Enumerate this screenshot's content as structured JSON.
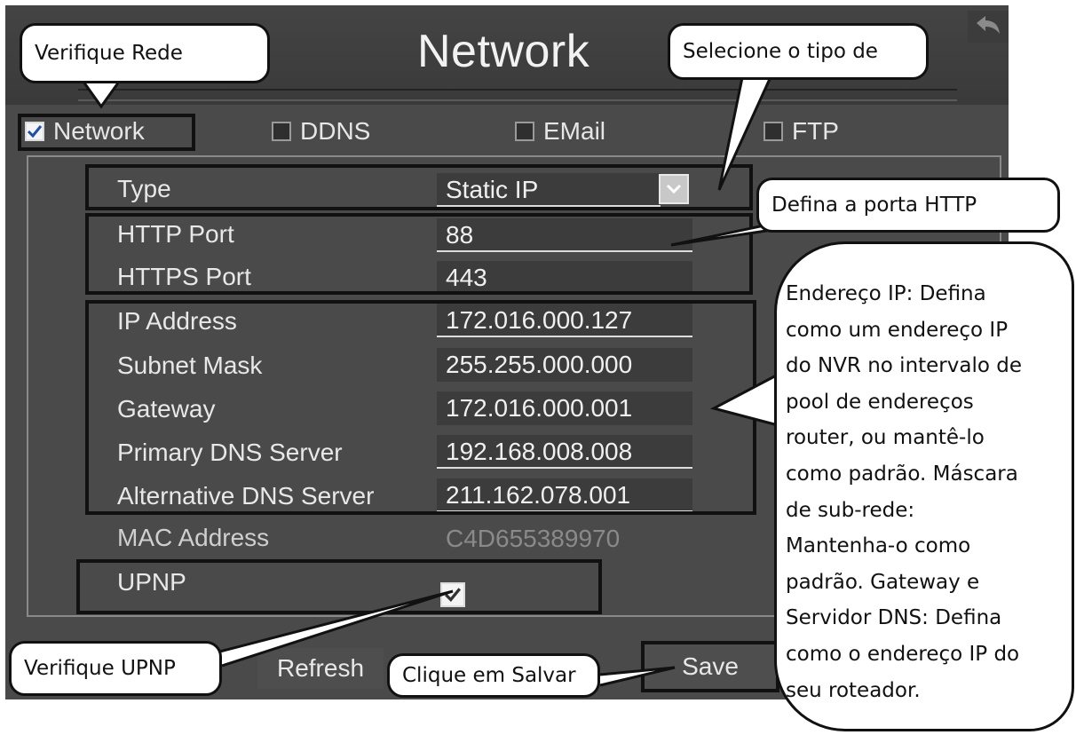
{
  "window": {
    "title": "Network"
  },
  "tabs": [
    {
      "label": "Network",
      "checked": true
    },
    {
      "label": "DDNS",
      "checked": false
    },
    {
      "label": "EMail",
      "checked": false
    },
    {
      "label": "FTP",
      "checked": false
    }
  ],
  "form": {
    "type": {
      "label": "Type",
      "value": "Static IP"
    },
    "http_port": {
      "label": "HTTP Port",
      "value": "88"
    },
    "https_port": {
      "label": "HTTPS Port",
      "value": "443"
    },
    "ip_address": {
      "label": "IP Address",
      "value": "172.016.000.127"
    },
    "subnet_mask": {
      "label": "Subnet Mask",
      "value": "255.255.000.000"
    },
    "gateway": {
      "label": "Gateway",
      "value": "172.016.000.001"
    },
    "primary_dns": {
      "label": "Primary DNS Server",
      "value": "192.168.008.008"
    },
    "alternative_dns": {
      "label": "Alternative DNS Server",
      "value": "211.162.078.001"
    },
    "mac_address": {
      "label": "MAC Address",
      "value": "C4D655389970"
    },
    "upnp": {
      "label": "UPNP",
      "checked": true
    }
  },
  "buttons": {
    "refresh": "Refresh",
    "save": "Save"
  },
  "callouts": {
    "verify_network": "Verifique Rede",
    "select_type": "Selecione o tipo de",
    "http_port": "Defina a porta HTTP",
    "ip_info_lines": [
      "Endereço IP: Defina",
      "como um endereço IP",
      "do NVR no intervalo de",
      "pool de endereços",
      "router, ou mantê-lo",
      "como padrão. Máscara",
      "de sub-rede:",
      "Mantenha-o como",
      "padrão. Gateway e",
      "Servidor DNS: Defina",
      "como o endereço IP do",
      "seu roteador."
    ],
    "verify_upnp": "Verifique UPNP",
    "click_save": "Clique em Salvar"
  },
  "icons": {
    "back": "back-arrow-icon",
    "checkmark": "checkmark-icon",
    "dropdown": "chevron-down-icon"
  },
  "colors": {
    "screen_bg": "#4a4a4a",
    "text": "#e8e8e8",
    "callout_bg": "#ffffff",
    "highlight_border": "#111111"
  }
}
